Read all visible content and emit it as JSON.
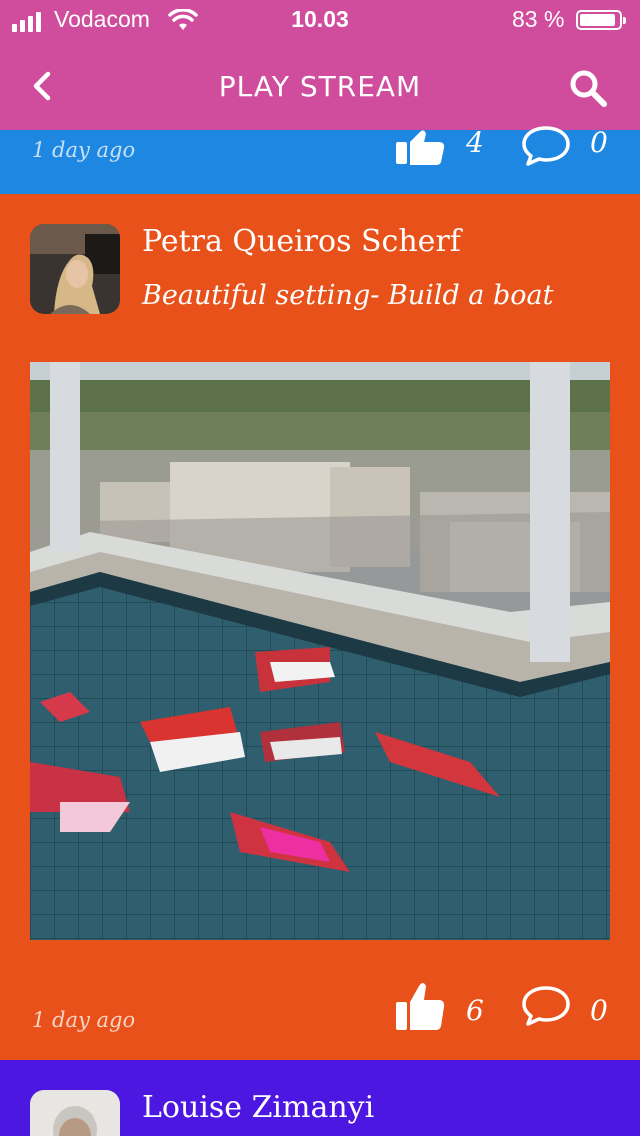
{
  "status_bar": {
    "carrier": "Vodacom",
    "time": "10.03",
    "battery": "83 %",
    "battery_level": 0.83
  },
  "nav": {
    "title": "PLAY STREAM",
    "back_icon": "chevron-left-icon",
    "search_icon": "search-icon"
  },
  "colors": {
    "nav": "#cf4d9c",
    "card_blue": "#1e87e2",
    "card_orange": "#e8511a",
    "card_purple": "#4c17e0"
  },
  "posts": [
    {
      "time_ago": "1 day ago",
      "likes": "4",
      "comments": "0"
    },
    {
      "author": "Petra Queiros Scherf",
      "caption": "Beautiful setting- Build a boat",
      "time_ago": "1 day ago",
      "likes": "6",
      "comments": "0"
    },
    {
      "author": "Louise Zimanyi"
    }
  ]
}
